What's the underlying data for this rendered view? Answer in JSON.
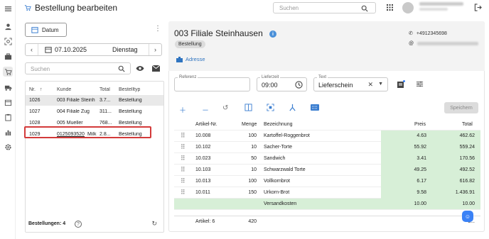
{
  "app": {
    "title": "Bestellung bearbeiten",
    "search_placeholder": "Suchen",
    "user_name": "Natalia Frankfurst",
    "user_role": "Verkauf"
  },
  "rail": {
    "icons": [
      "menu-icon",
      "person-icon",
      "scan-icon",
      "briefcase-icon",
      "cart-icon",
      "truck-icon",
      "calendar-icon",
      "clipboard-icon",
      "chart-icon",
      "settings-icon"
    ]
  },
  "left": {
    "date_button": "Datum",
    "date": "07.10.2025",
    "weekday": "Dienstag",
    "search_placeholder": "Suchen",
    "columns": [
      "Nr.",
      "Kunde",
      "Total",
      "Bestelltyp"
    ],
    "rows": [
      {
        "nr": "1026",
        "kunde": "003 Filiale Steinh",
        "total": "3.7...",
        "typ": "Bestellung"
      },
      {
        "nr": "1027",
        "kunde": "004 Filiale Zug",
        "total": "311...",
        "typ": "Bestellung"
      },
      {
        "nr": "1028",
        "kunde": "005 Mueller",
        "total": "768...",
        "typ": "Bestellung"
      },
      {
        "nr": "1029",
        "kunde": "0125093520",
        "kunde_suffix": "Milk",
        "total": "2.8...",
        "typ": "Bestellung"
      }
    ],
    "footer": "Bestellungen: 4"
  },
  "order": {
    "title": "003 Filiale Steinhausen",
    "badge": "Bestellung",
    "address_link": "Adresse",
    "phone": "+4912345698",
    "email": "natalia@example.com",
    "referenz_label": "Referenz",
    "referenz_value": "",
    "lieferzeit_label": "Lieferzeit",
    "lieferzeit_value": "09:00",
    "text_label": "Text",
    "text_value": "Lieferschein",
    "save_label": "Speichern",
    "columns": [
      "Artikel-Nr.",
      "Menge",
      "Bezeichnung",
      "Preis",
      "Total"
    ],
    "items": [
      {
        "nr": "10.008",
        "menge": "100",
        "bez": "Kartoffel-Roggenbrot",
        "preis": "4.63",
        "total": "462.62"
      },
      {
        "nr": "10.102",
        "menge": "10",
        "bez": "Sacher-Torte",
        "preis": "55.92",
        "total": "559.24"
      },
      {
        "nr": "10.023",
        "menge": "50",
        "bez": "Sandwich",
        "preis": "3.41",
        "total": "170.56"
      },
      {
        "nr": "10.103",
        "menge": "10",
        "bez": "Schwarzwald Torte",
        "preis": "49.25",
        "total": "492.52"
      },
      {
        "nr": "10.013",
        "menge": "100",
        "bez": "Vollkornbrot",
        "preis": "6.17",
        "total": "616.82"
      },
      {
        "nr": "10.011",
        "menge": "150",
        "bez": "Urkorn-Brot",
        "preis": "9.58",
        "total": "1.436.91"
      }
    ],
    "shipping_label": "Versandkosten",
    "shipping_preis": "10.00",
    "shipping_total": "10.00",
    "summary_articles": "Artikel: 6",
    "summary_menge": "420",
    "summary_total": "3..."
  }
}
